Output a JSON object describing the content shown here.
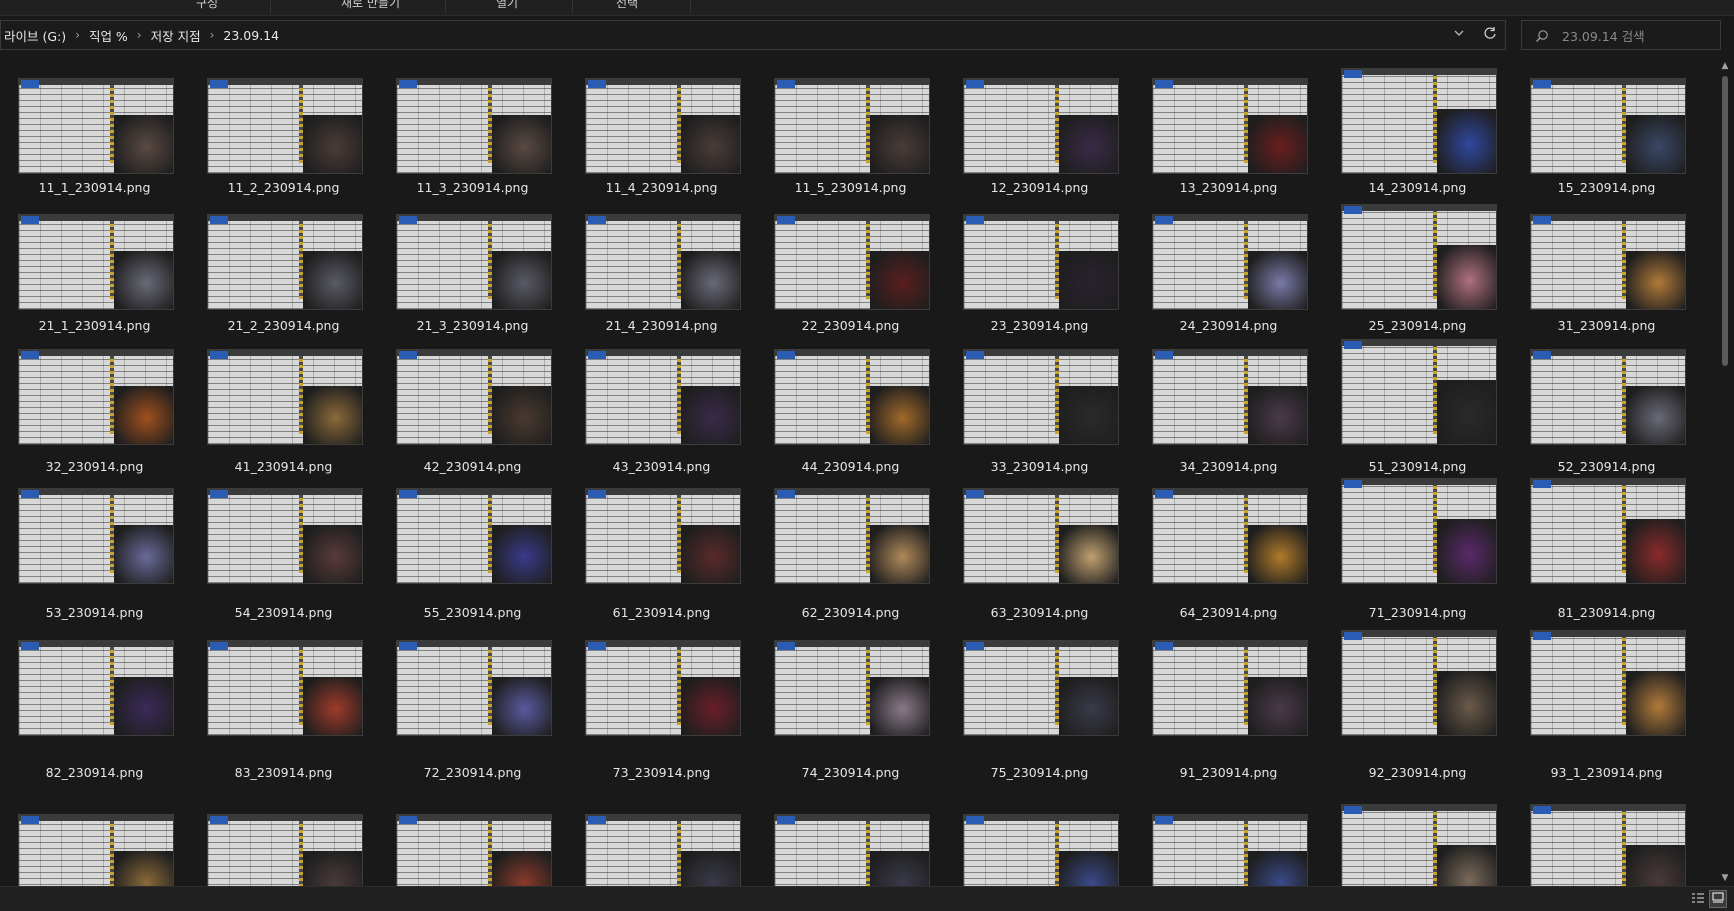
{
  "ribbon": {
    "items": [
      {
        "label": "구성"
      },
      {
        "label": "새로 만들기"
      },
      {
        "label": "열기"
      },
      {
        "label": "선택"
      }
    ]
  },
  "address": {
    "crumbs": [
      "라이브 (G:)",
      "직업 %",
      "저장 지점",
      "23.09.14"
    ],
    "separator": "›",
    "dropdown_icon": "chevron-down-icon",
    "refresh_icon": "refresh-icon"
  },
  "search": {
    "placeholder": "23.09.14 검색",
    "icon": "search-icon"
  },
  "files": [
    [
      "11_1_230914.png",
      "11_2_230914.png",
      "11_3_230914.png",
      "11_4_230914.png",
      "11_5_230914.png",
      "12_230914.png",
      "13_230914.png",
      "14_230914.png",
      "15_230914.png"
    ],
    [
      "21_1_230914.png",
      "21_2_230914.png",
      "21_3_230914.png",
      "21_4_230914.png",
      "22_230914.png",
      "23_230914.png",
      "24_230914.png",
      "25_230914.png",
      "31_230914.png"
    ],
    [
      "32_230914.png",
      "41_230914.png",
      "42_230914.png",
      "43_230914.png",
      "44_230914.png",
      "33_230914.png",
      "34_230914.png",
      "51_230914.png",
      "52_230914.png"
    ],
    [
      "53_230914.png",
      "54_230914.png",
      "55_230914.png",
      "61_230914.png",
      "62_230914.png",
      "63_230914.png",
      "64_230914.png",
      "71_230914.png",
      "81_230914.png"
    ],
    [
      "82_230914.png",
      "83_230914.png",
      "72_230914.png",
      "73_230914.png",
      "74_230914.png",
      "75_230914.png",
      "91_230914.png",
      "92_230914.png",
      "93_1_230914.png"
    ]
  ],
  "partial_row_count": 9,
  "art_colors": [
    [
      "#5a4a44",
      "#4a3c38",
      "#5a4a44",
      "#4a3c38",
      "#4a3c38",
      "#3a2a48",
      "#6a1e1e",
      "#3048a0",
      "#3a4868"
    ],
    [
      "#6a6a78",
      "#5a5a66",
      "#5a5a66",
      "#6a6a78",
      "#5a1e1e",
      "#2a2230",
      "#7a7aa8",
      "#b07080",
      "#b07a3a"
    ],
    [
      "#a0501e",
      "#8a6a3a",
      "#4a3a30",
      "#3a2a4a",
      "#a06a2a",
      "#2a2a2a",
      "#4a3a4a",
      "#2a2a2a",
      "#6a6a78"
    ],
    [
      "#6a6a9a",
      "#5a3a3a",
      "#3a3a8a",
      "#5a2a2a",
      "#b08a5a",
      "#c0a070",
      "#b07a2a",
      "#5a2a6a",
      "#8a2a2a"
    ],
    [
      "#3a2a5a",
      "#a03a2a",
      "#5a5aa0",
      "#6a1e2a",
      "#8a7a8a",
      "#3a3a4a",
      "#4a3a4a",
      "#6a5a4a",
      "#b07a3a"
    ],
    [
      "#8a6a3a",
      "#4a3a3a",
      "#8a3a2a",
      "#3a3a4a",
      "#3a3a4a",
      "#3a4a8a",
      "#3a4a8a",
      "#7a6a5a",
      "#4a3a3a"
    ]
  ],
  "status": {
    "details_view_icon": "details-view-icon",
    "large_icons_view_icon": "large-icons-view-icon"
  }
}
